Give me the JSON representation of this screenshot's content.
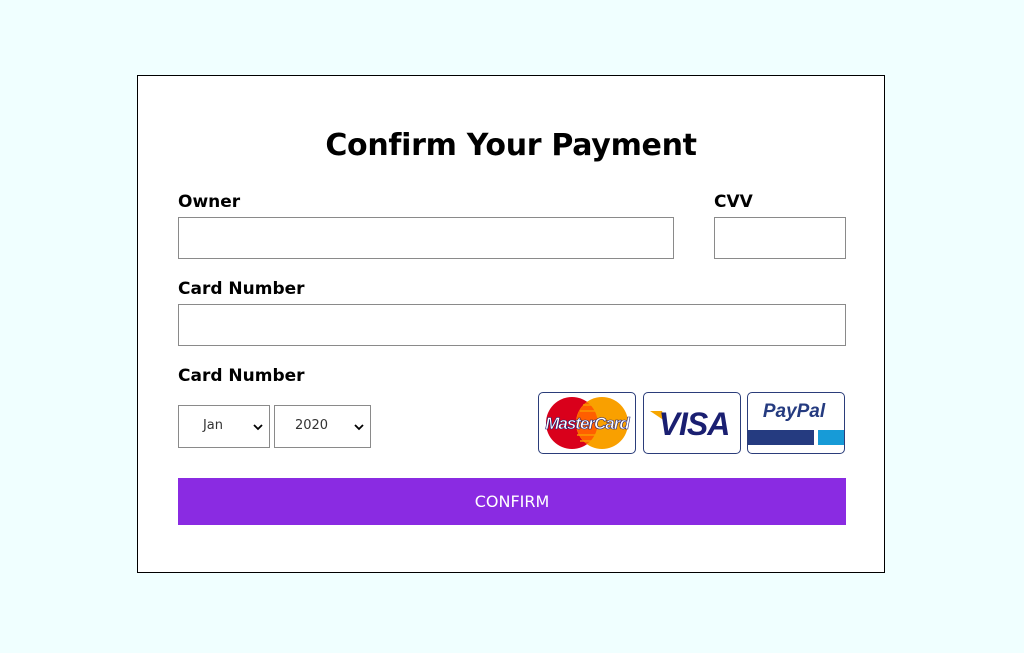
{
  "form": {
    "title": "Confirm Your Payment",
    "owner_label": "Owner",
    "owner_value": "",
    "cvv_label": "CVV",
    "cvv_value": "",
    "card_number_label": "Card Number",
    "card_number_value": "",
    "expiry_label": "Card Number",
    "month_selected": "Jan",
    "year_selected": "2020",
    "confirm_label": "CONFIRM"
  },
  "payment_logos": [
    {
      "name": "mastercard",
      "text": "MasterCard"
    },
    {
      "name": "visa",
      "text": "VISA"
    },
    {
      "name": "paypal",
      "text": "PayPal"
    }
  ],
  "colors": {
    "page_background": "#f0ffff",
    "card_background": "#ffffff",
    "accent": "#8a2be2",
    "field_border": "#8a8a8a"
  },
  "icons": [
    "chevron-down-icon",
    "mastercard-logo-icon",
    "visa-logo-icon",
    "paypal-logo-icon"
  ]
}
